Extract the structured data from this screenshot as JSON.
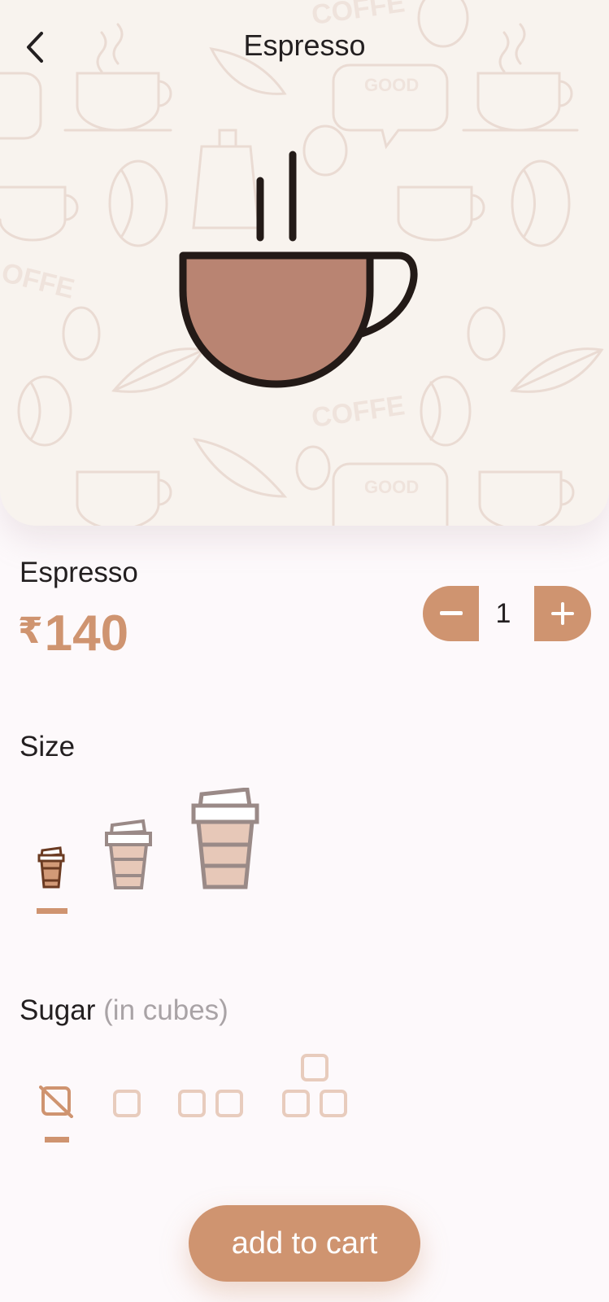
{
  "header": {
    "title": "Espresso"
  },
  "product": {
    "name": "Espresso",
    "currency": "₹",
    "price": "140"
  },
  "quantity": {
    "value": "1"
  },
  "size": {
    "label": "Size",
    "options": [
      "small",
      "medium",
      "large"
    ],
    "selected": "small"
  },
  "sugar": {
    "label": "Sugar",
    "sub_label": "(in cubes)",
    "options": [
      0,
      1,
      2,
      3
    ],
    "selected": 0
  },
  "cart": {
    "button_label": "add to cart"
  },
  "colors": {
    "accent": "#cf9470",
    "cup_fill": "#b98472",
    "outline": "#231a17",
    "background": "#f8f3ee",
    "page": "#fdf9fb"
  },
  "icons": [
    "back-arrow-icon",
    "coffee-cup-icon",
    "minus-icon",
    "plus-icon",
    "small-cup-icon",
    "medium-cup-icon",
    "large-cup-icon",
    "no-sugar-icon",
    "one-cube-icon",
    "two-cubes-icon",
    "three-cubes-icon"
  ]
}
